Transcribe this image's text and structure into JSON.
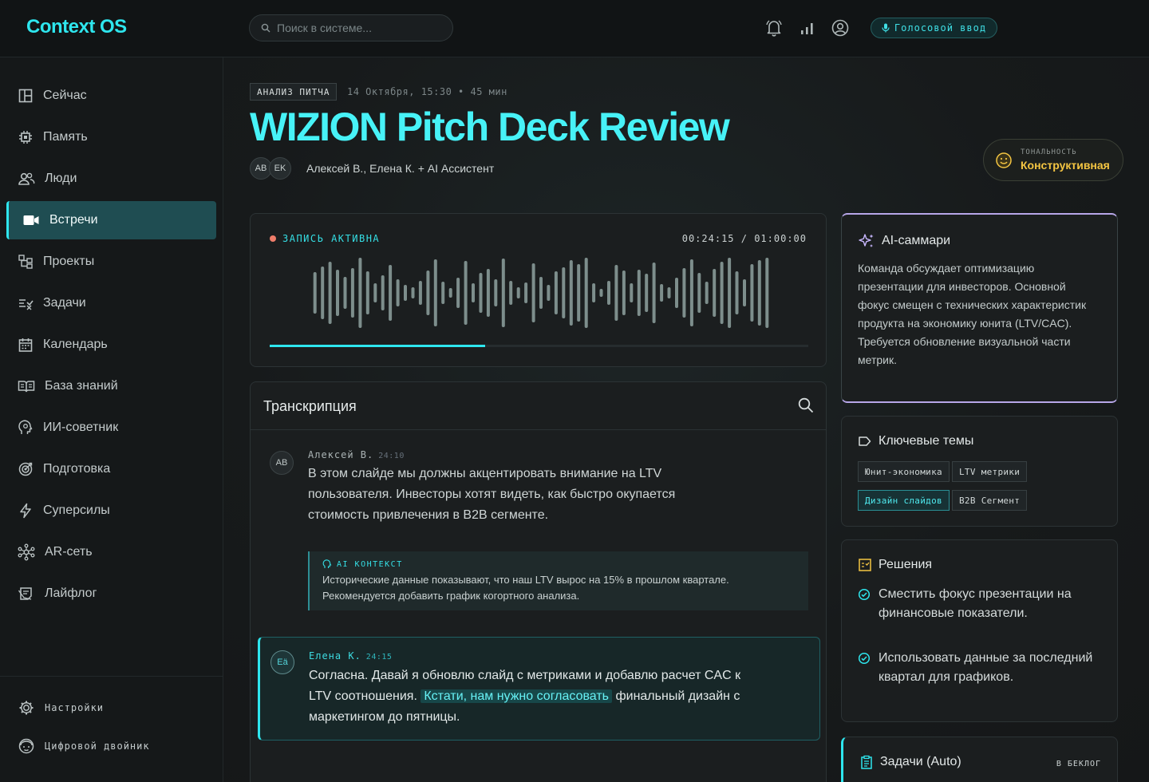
{
  "app": {
    "brand": "Context OS"
  },
  "topbar": {
    "search_placeholder": "Поиск в системе...",
    "voice_label": "Голосовой ввод",
    "icons": [
      "bell-icon",
      "signal-bars-icon",
      "user-circle-icon"
    ]
  },
  "sidebar": {
    "items": [
      {
        "label": "Сейчас",
        "icon": "layout-icon"
      },
      {
        "label": "Память",
        "icon": "chip-icon"
      },
      {
        "label": "Люди",
        "icon": "people-icon"
      },
      {
        "label": "Встречи",
        "icon": "video-icon",
        "active": true
      },
      {
        "label": "Проекты",
        "icon": "hierarchy-icon"
      },
      {
        "label": "Задачи",
        "icon": "task-list-icon"
      },
      {
        "label": "Календарь",
        "icon": "calendar-icon"
      },
      {
        "label": "База знаний",
        "icon": "book-icon"
      },
      {
        "label": "ИИ-советник",
        "icon": "brain-head-icon"
      },
      {
        "label": "Подготовка",
        "icon": "target-icon"
      },
      {
        "label": "Суперсилы",
        "icon": "bolt-icon"
      },
      {
        "label": "AR-сеть",
        "icon": "network-icon"
      },
      {
        "label": "Лайфлог",
        "icon": "log-icon"
      }
    ],
    "settings_label": "Настройки",
    "twin_label": "Цифровой двойник"
  },
  "meeting": {
    "category": "АНАЛИЗ ПИТЧА",
    "meta": "14 Октября, 15:30 • 45 мин",
    "title": "WIZION Pitch Deck Review",
    "avatars": [
      "AB",
      "EK"
    ],
    "participants": "Алексей В., Елена К. + AI Ассистент",
    "tone_label": "ТОНАЛЬНОСТЬ",
    "tone_value": "Конструктивная",
    "accent": "#2ee6ee",
    "tone_color": "#f4c542"
  },
  "recording": {
    "status": "ЗАПИСЬ АКТИВНА",
    "time": "00:24:15 / 01:00:00",
    "progress": 0.4
  },
  "transcript": {
    "title": "Транскрипция",
    "messages": [
      {
        "avatar": "AB",
        "name": "Алексей В.",
        "time": "24:10",
        "text": "В этом слайде мы должны акцентировать внимание на LTV пользователя. Инвесторы хотят видеть, как быстро окупается стоимость привлечения в B2B сегменте."
      },
      {
        "avatar": "Eä",
        "name": "Елена К.",
        "time": "24:15",
        "text_before": "Согласна. Давай я обновлю слайд с метриками и добавлю расчет CAC к LTV соотношения.",
        "text_highlight": "Кстати, нам нужно согласовать",
        "text_after": "финальный дизайн с маркетингом до пятницы."
      }
    ],
    "ai_context": {
      "label": "AI КОНТЕКСТ",
      "text": "Исторические данные показывают, что наш LTV вырос на 15% в прошлом квартале. Рекомендуется добавить график когортного анализа."
    }
  },
  "summary": {
    "title": "AI-саммари",
    "text": "Команда обсуждает оптимизацию презентации для инвесторов. Основной фокус смещен с технических характеристик продукта на экономику юнита (LTV/CAC). Требуется обновление визуальной части метрик."
  },
  "themes": {
    "title": "Ключевые темы",
    "chips": [
      "Юнит-экономика",
      "LTV метрики",
      "Дизайн слайдов",
      "B2B Сегмент"
    ]
  },
  "decisions": {
    "title": "Решения",
    "items": [
      "Сместить фокус презентации на финансовые показатели.",
      "Использовать данные за последний квартал для графиков."
    ]
  },
  "tasks": {
    "title": "Задачи (Auto)",
    "backlog_label": "В БЕКЛОГ"
  }
}
